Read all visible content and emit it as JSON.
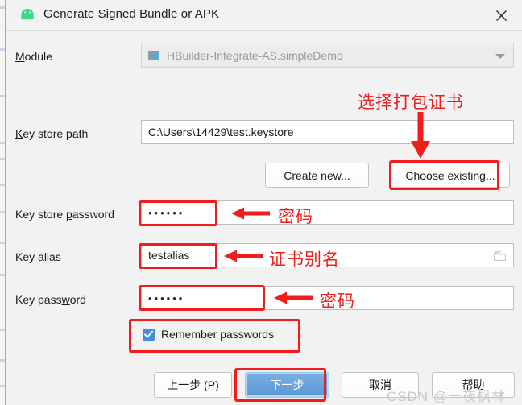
{
  "window": {
    "title": "Generate Signed Bundle or APK",
    "app_icon": "android-robot-icon",
    "close_icon": "close-icon"
  },
  "form": {
    "module": {
      "label": "Module",
      "label_mnemonic": "M",
      "value": "HBuilder-Integrate-AS.simpleDemo",
      "icon": "module-folder-icon",
      "dropdown_icon": "chevron-down-icon",
      "disabled": true
    },
    "key_store_path": {
      "label": "Key store path",
      "label_mnemonic": "K",
      "value": "C:\\Users\\14429\\test.keystore",
      "placeholder": ""
    },
    "create_new_button": {
      "label": "Create new...",
      "mnemonic": "C"
    },
    "choose_existing_button": {
      "label": "Choose existing...",
      "mnemonic": "h"
    },
    "key_store_password": {
      "label": "Key store password",
      "label_mnemonic": "p",
      "value": "••••••",
      "masked_length": 6
    },
    "key_alias": {
      "label": "Key alias",
      "label_mnemonic": "e",
      "value": "testalias",
      "browse_icon": "folder-icon"
    },
    "key_password": {
      "label": "Key password",
      "label_mnemonic": "w",
      "value": "••••••",
      "masked_length": 6
    },
    "remember_passwords": {
      "label": "Remember passwords",
      "label_mnemonic": "R",
      "checked": true,
      "check_icon": "checkmark-icon"
    }
  },
  "footer": {
    "previous_button": "上一步 (P)",
    "next_button": "下一步",
    "cancel_button": "取消",
    "help_button": "帮助"
  },
  "annotations": {
    "choose_cert": "选择打包证书",
    "password_1": "密码",
    "alias_name": "证书别名",
    "password_2": "密码",
    "highlight_color": "#f01d1d"
  },
  "watermark": {
    "text": "CSDN @一夜枫林",
    "color": "#c9c9c9"
  },
  "colors": {
    "dialog_bg": "#f2f2f2",
    "field_bg": "#ffffff",
    "field_border": "#bdbdbd",
    "primary_button": "#5a96d4",
    "checkbox_accent": "#3f8fdc",
    "annotation_red": "#f01d1d",
    "android_green": "#3ddc84"
  }
}
